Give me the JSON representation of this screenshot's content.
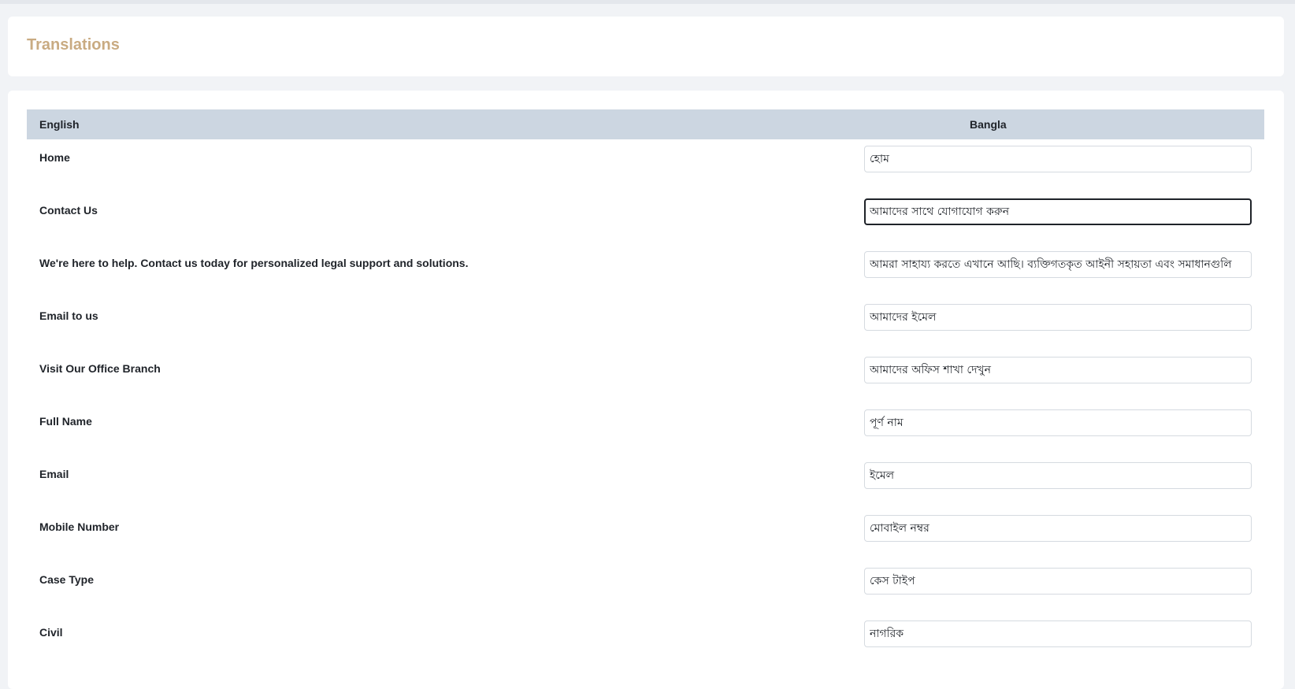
{
  "page": {
    "title": "Translations"
  },
  "table": {
    "headers": {
      "english": "English",
      "bangla": "Bangla"
    },
    "rows": [
      {
        "english": "Home",
        "bangla": "হোম"
      },
      {
        "english": "Contact Us",
        "bangla": "আমাদের সাথে যোগাযোগ করুন"
      },
      {
        "english": "We're here to help. Contact us today for personalized legal support and solutions.",
        "bangla": "আমরা সাহায্য করতে এখানে আছি। ব্যক্তিগতকৃত আইনী সহায়তা এবং সমাধানগুলি"
      },
      {
        "english": "Email to us",
        "bangla": "আমাদের ইমেল"
      },
      {
        "english": "Visit Our Office Branch",
        "bangla": "আমাদের অফিস শাখা দেখুন"
      },
      {
        "english": "Full Name",
        "bangla": "পূর্ণ নাম"
      },
      {
        "english": "Email",
        "bangla": "ইমেল"
      },
      {
        "english": "Mobile Number",
        "bangla": "মোবাইল নম্বর"
      },
      {
        "english": "Case Type",
        "bangla": "কেস টাইপ"
      },
      {
        "english": "Civil",
        "bangla": "নাগরিক"
      }
    ]
  }
}
